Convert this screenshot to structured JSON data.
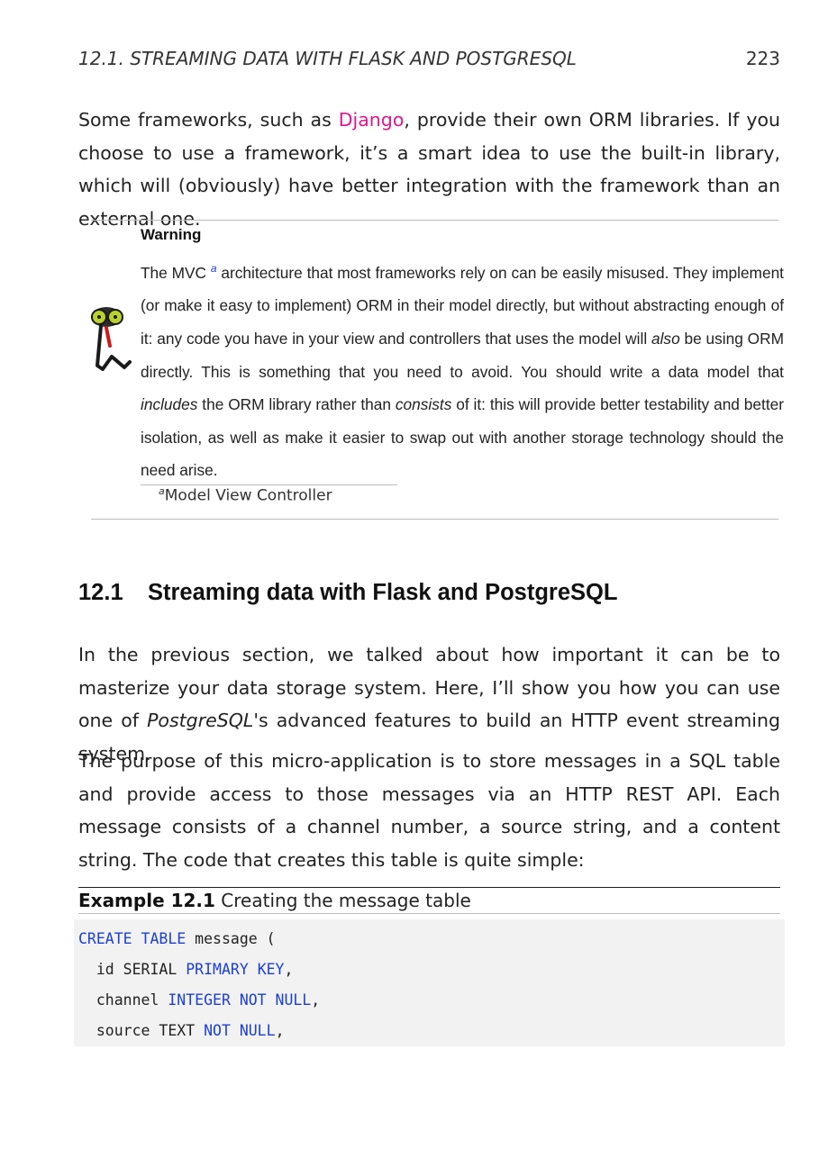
{
  "header": {
    "running_title": "12.1.  STREAMING DATA WITH FLASK AND POSTGRESQL",
    "page_number": "223"
  },
  "intro": {
    "before_link": "Some frameworks, such as ",
    "link": "Django",
    "after_link": ", provide their own ORM libraries. If you choose to use a framework, it’s a smart idea to use the built-in library, which will (obviously) have better integration with the framework than an external one."
  },
  "warning": {
    "title": "Warning",
    "t1": "The MVC ",
    "footnote_mark": "a",
    "t2": " architecture that most frameworks rely on can be easily misused. They implement (or make it easy to implement) ORM in their model directly, but without abstracting enough of it: any code you have in your view and controllers that uses the model will ",
    "em1": "also",
    "t3": " be using ORM directly.  This is something that you need to avoid.  You should write a data model that ",
    "em2": "includes",
    "t4": " the ORM library rather than ",
    "em3": "consists",
    "t5": " of it: this will provide better testability and better isolation, as well as make it easier to swap out with another storage technology should the need arise.",
    "footnote_text": "Model View Controller",
    "icon": "bug-mascot-icon"
  },
  "section": {
    "number": "12.1",
    "title": "Streaming data with Flask and PostgreSQL"
  },
  "para1": {
    "t1": "In the previous section, we talked about how important it can be to masterize your data storage system.  Here, I’ll show you how you can use one of ",
    "em": "PostgreSQL",
    "t2": "'s advanced features to build an HTTP event streaming system."
  },
  "para2": {
    "text": "The purpose of this micro-application is to store messages in a SQL table and provide access to those messages via an HTTP REST API. Each message consists of a channel number, a source string, and a content string.  The code that creates this table is quite simple:"
  },
  "example": {
    "label": "Example 12.1",
    "caption": " Creating the message table"
  },
  "code": {
    "l1_kw": "CREATE TABLE",
    "l1_rest": " message (",
    "l2_a": "  id SERIAL ",
    "l2_kw": "PRIMARY KEY",
    "l2_b": ",",
    "l3_a": "  channel ",
    "l3_kw": "INTEGER NOT NULL",
    "l3_b": ",",
    "l4_a": "  source TEXT ",
    "l4_kw": "NOT NULL",
    "l4_b": ","
  },
  "colors": {
    "link": "#e0168c",
    "keyword": "#1c3fd8",
    "code_bg": "#f2f2f2"
  }
}
